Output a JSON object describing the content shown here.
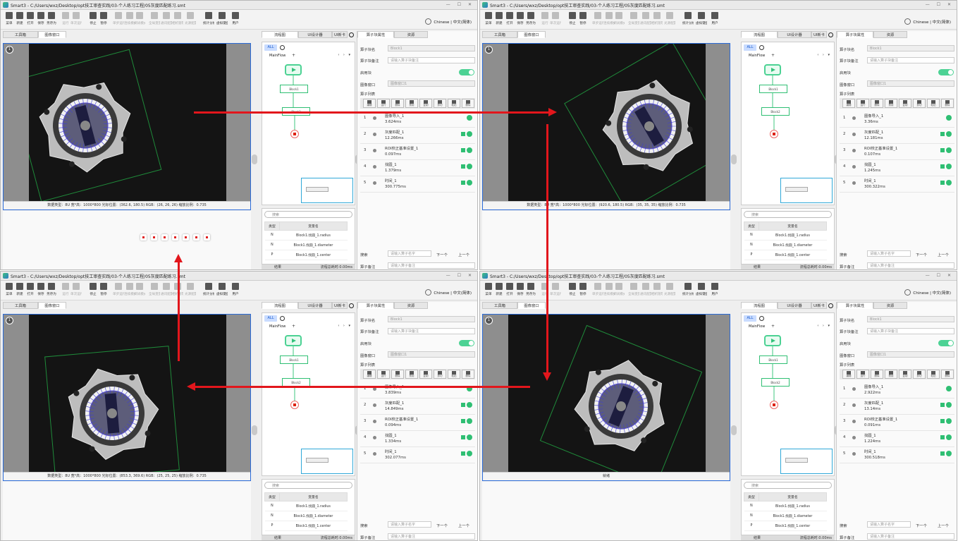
{
  "app": {
    "title": "Smart3 - C:/Users/wxz/Desktop/opt技工审查实践/03-个人练习工程/05灰度匹配练习.smt",
    "title_short": "Smart3 - C:/Users/wxz/Desktop/opt技工审查实践/03-个人练习工程/05灰度匹配练习.smt",
    "window_controls": "— ☐ ✕",
    "language": "Chinese | 中文(简体)"
  },
  "toolbar": [
    {
      "label": "菜单",
      "icon": "menu-icon",
      "dim": false
    },
    {
      "label": "新建",
      "icon": "new-file-icon",
      "dim": false
    },
    {
      "label": "打开",
      "icon": "open-folder-icon",
      "dim": false
    },
    {
      "label": "保存",
      "icon": "save-icon",
      "dim": false
    },
    {
      "label": "另存为",
      "icon": "save-as-icon",
      "dim": false
    },
    {
      "label": "运行",
      "icon": "run-icon",
      "dim": true
    },
    {
      "label": "单次运行",
      "icon": "run-once-icon",
      "dim": true
    },
    {
      "label": "停止",
      "icon": "stop-icon",
      "dim": false
    },
    {
      "label": "暂停",
      "icon": "pause-icon",
      "dim": false
    },
    {
      "label": "单步运行",
      "icon": "step-icon",
      "dim": true
    },
    {
      "label": "连续模式",
      "icon": "continuous-icon",
      "dim": true
    },
    {
      "label": "调试模式",
      "icon": "debug-icon",
      "dim": true
    },
    {
      "label": "全局变量",
      "icon": "global-var-icon",
      "dim": true
    },
    {
      "label": "通讯配置",
      "icon": "comm-icon",
      "dim": true
    },
    {
      "label": "相机管理",
      "icon": "camera-icon",
      "dim": true
    },
    {
      "label": "光源配置",
      "icon": "light-icon",
      "dim": true
    },
    {
      "label": "统计分析",
      "icon": "stats-icon",
      "dim": false
    },
    {
      "label": "虚拟键盘",
      "icon": "keyboard-icon",
      "dim": false
    },
    {
      "label": "用户",
      "icon": "user-icon",
      "dim": false
    }
  ],
  "tabs": {
    "toolbox": "工具箱",
    "image_window": "图像窗口",
    "flow_chart": "流程图",
    "ui_designer": "UI设计器",
    "ui_new": "UI新卡",
    "op_props": "算子块属性",
    "resources": "资源"
  },
  "flow": {
    "all": "ALL",
    "mainflow": "MainFlow",
    "plus": "+",
    "nav": "‹ › ▾",
    "block1": "Block1",
    "block2": "Block2"
  },
  "vars": {
    "search_placeholder": "搜索",
    "headers": [
      "类型",
      "变量名"
    ],
    "rows": [
      {
        "type": "N",
        "name": "Block1.找圆_1.radius"
      },
      {
        "type": "N",
        "name": "Block1.找圆_1.diameter"
      },
      {
        "type": "P",
        "name": "Block1.找圆_1.center"
      }
    ],
    "footer_left": "结果",
    "footer_right": "流程总耗时:0.00ms"
  },
  "props": {
    "name_label": "算子块名",
    "name_value": "Block1",
    "remark_label": "算子块备注",
    "remark_placeholder": "请输入算子块备注",
    "enable_label": "启用块",
    "image_window_label": "图像窗口",
    "image_window_value": "图像窗口1",
    "list_label": "算子列表",
    "ops_toolbar": [
      "编辑",
      "运行",
      "删除",
      "禁用",
      "复制",
      "剪切",
      "粘贴",
      "删除"
    ],
    "search_label": "搜索",
    "search_placeholder": "请输入算子名字",
    "prev": "下一个",
    "next": "上一个",
    "op_remark_label": "算子备注",
    "op_remark_placeholder": "请输入算子备注"
  },
  "windows": [
    {
      "status": "数据类型：8U 宽*高：1000*800 光标位置：(362.6, 180.5) RGB：(26, 26, 26) 缩放比例：0.735",
      "ops": [
        {
          "num": "1",
          "name": "图像导入_1",
          "time": "3.624ms"
        },
        {
          "num": "2",
          "name": "灰度匹配_1",
          "time": "12.266ms"
        },
        {
          "num": "3",
          "name": "ROI校正基准设置_1",
          "time": "0.097ms"
        },
        {
          "num": "4",
          "name": "找圆_1",
          "time": "1.379ms"
        },
        {
          "num": "5",
          "name": "时间_1",
          "time": "300.775ms"
        }
      ]
    },
    {
      "status": "数据类型：8U 宽*高：1000*800 光标位置：(920.6, 180.5) RGB：(35, 35, 35) 缩放比例：0.735",
      "ops": [
        {
          "num": "1",
          "name": "图像导入_1",
          "time": "3.36ms"
        },
        {
          "num": "2",
          "name": "灰度匹配_1",
          "time": "12.181ms"
        },
        {
          "num": "3",
          "name": "ROI校正基准设置_1",
          "time": "0.107ms"
        },
        {
          "num": "4",
          "name": "找圆_1",
          "time": "1.245ms"
        },
        {
          "num": "5",
          "name": "时间_1",
          "time": "300.322ms"
        }
      ]
    },
    {
      "status": "数据类型：8U 宽*高：1000*800 光标位置：(853.3, 369.6) RGB：(25, 25, 25) 缩放比例：0.735",
      "ops": [
        {
          "num": "1",
          "name": "图像导入_1",
          "time": "3.839ms"
        },
        {
          "num": "2",
          "name": "灰度匹配_1",
          "time": "14.849ms"
        },
        {
          "num": "3",
          "name": "ROI校正基准设置_1",
          "time": "0.094ms"
        },
        {
          "num": "4",
          "name": "找圆_1",
          "time": "1.334ms"
        },
        {
          "num": "5",
          "name": "时间_1",
          "time": "302.077ms"
        }
      ]
    },
    {
      "status": "就绪",
      "ops": [
        {
          "num": "1",
          "name": "图像导入_1",
          "time": "2.922ms"
        },
        {
          "num": "2",
          "name": "灰度匹配_1",
          "time": "13.14ms"
        },
        {
          "num": "3",
          "name": "ROI校正基准设置_1",
          "time": "0.091ms"
        },
        {
          "num": "4",
          "name": "找圆_1",
          "time": "1.224ms"
        },
        {
          "num": "5",
          "name": "时间_1",
          "time": "300.518ms"
        }
      ]
    }
  ]
}
